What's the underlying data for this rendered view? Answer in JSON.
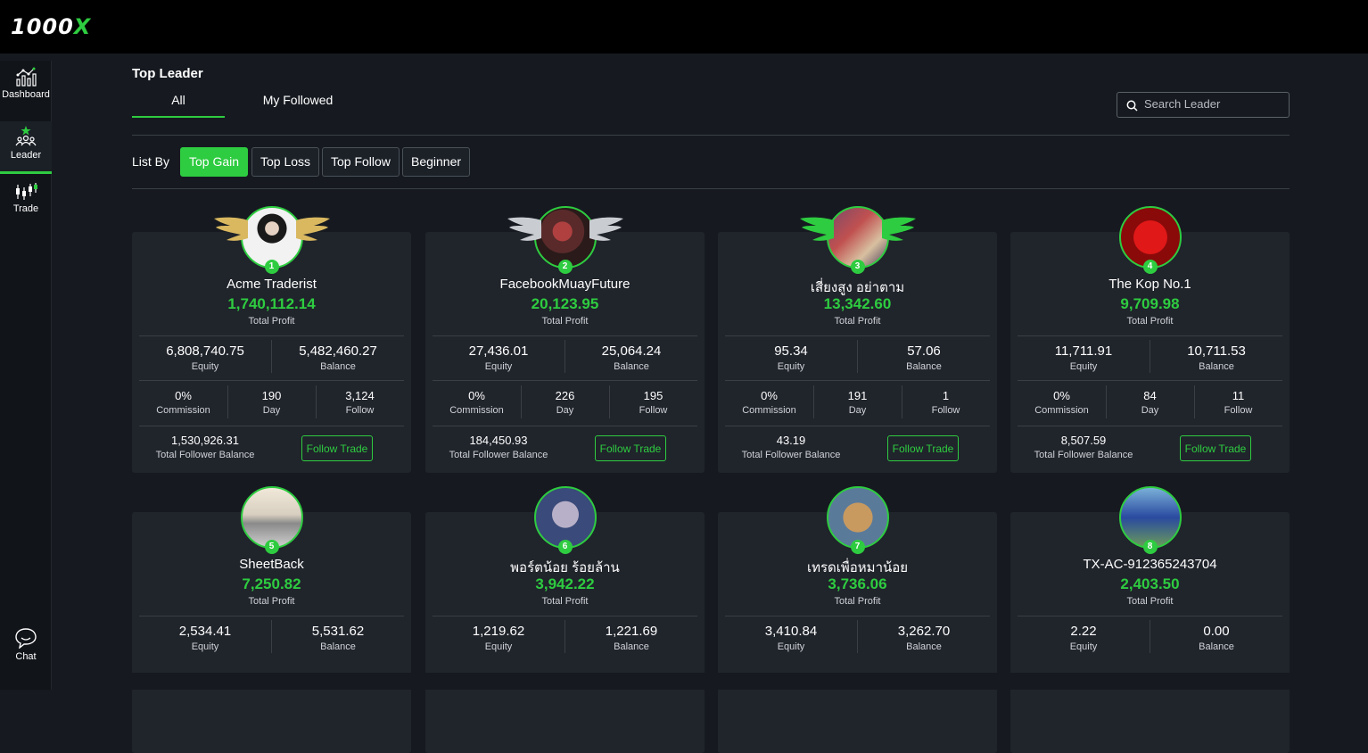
{
  "brand": {
    "logo_main": "1000",
    "logo_x": "X"
  },
  "sidebar": {
    "items": [
      {
        "label": "Dashboard"
      },
      {
        "label": "Leader"
      },
      {
        "label": "Trade"
      }
    ],
    "chat_label": "Chat"
  },
  "page": {
    "title": "Top Leader"
  },
  "tabs": [
    {
      "label": "All"
    },
    {
      "label": "My Followed"
    }
  ],
  "search": {
    "placeholder": "Search Leader"
  },
  "list_by": {
    "label": "List By",
    "options": [
      {
        "label": "Top Gain"
      },
      {
        "label": "Top Loss"
      },
      {
        "label": "Top Follow"
      },
      {
        "label": "Beginner"
      }
    ],
    "selected": "Top Gain"
  },
  "labels": {
    "total_profit": "Total Profit",
    "equity": "Equity",
    "balance": "Balance",
    "commission": "Commission",
    "day": "Day",
    "follow": "Follow",
    "total_follower_balance": "Total Follower Balance",
    "follow_trade": "Follow Trade"
  },
  "leaders": [
    {
      "rank": "1",
      "name": "Acme Traderist",
      "profit": "1,740,112.14",
      "equity": "6,808,740.75",
      "balance": "5,482,460.27",
      "commission": "0%",
      "day": "190",
      "follow": "3,124",
      "follower_balance": "1,530,926.31",
      "wing": "gold"
    },
    {
      "rank": "2",
      "name": "FacebookMuayFuture",
      "profit": "20,123.95",
      "equity": "27,436.01",
      "balance": "25,064.24",
      "commission": "0%",
      "day": "226",
      "follow": "195",
      "follower_balance": "184,450.93",
      "wing": "silver"
    },
    {
      "rank": "3",
      "name": "เสี่ยงสูง อย่าตาม",
      "profit": "13,342.60",
      "equity": "95.34",
      "balance": "57.06",
      "commission": "0%",
      "day": "191",
      "follow": "1",
      "follower_balance": "43.19",
      "wing": "green"
    },
    {
      "rank": "4",
      "name": "The Kop No.1",
      "profit": "9,709.98",
      "equity": "11,711.91",
      "balance": "10,711.53",
      "commission": "0%",
      "day": "84",
      "follow": "11",
      "follower_balance": "8,507.59",
      "wing": ""
    },
    {
      "rank": "5",
      "name": "SheetBack",
      "profit": "7,250.82",
      "equity": "2,534.41",
      "balance": "5,531.62",
      "wing": ""
    },
    {
      "rank": "6",
      "name": "พอร์ตน้อย ร้อยล้าน",
      "profit": "3,942.22",
      "equity": "1,219.62",
      "balance": "1,221.69",
      "wing": ""
    },
    {
      "rank": "7",
      "name": "เทรดเพื่อหมาน้อย",
      "profit": "3,736.06",
      "equity": "3,410.84",
      "balance": "3,262.70",
      "wing": ""
    },
    {
      "rank": "8",
      "name": "TX-AC-912365243704",
      "profit": "2,403.50",
      "equity": "2.22",
      "balance": "0.00",
      "wing": ""
    }
  ],
  "colors": {
    "accent": "#2ecc40",
    "card": "#20242b",
    "background": "#161a20"
  }
}
